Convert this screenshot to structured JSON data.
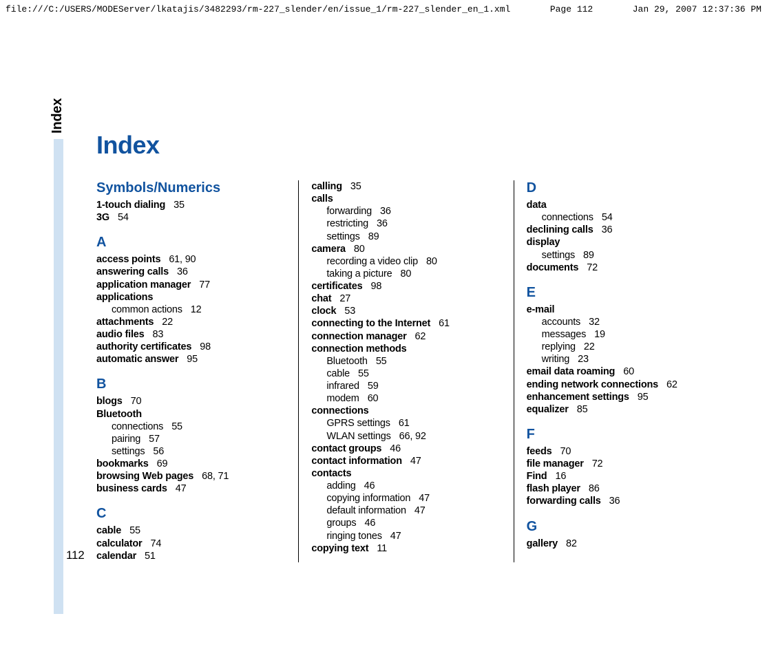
{
  "header": {
    "path": "file:///C:/USERS/MODEServer/lkatajis/3482293/rm-227_slender/en/issue_1/rm-227_slender_en_1.xml",
    "page_label": "Page 112",
    "timestamp": "Jan 29, 2007 12:37:36 PM"
  },
  "side_tab": "Index",
  "page_number": "112",
  "title": "Index",
  "columns": [
    {
      "sections": [
        {
          "letter": "Symbols/Numerics",
          "first": true,
          "entries": [
            {
              "term": "1-touch dialing",
              "pages": "35"
            },
            {
              "term": "3G",
              "pages": "54"
            }
          ]
        },
        {
          "letter": "A",
          "entries": [
            {
              "term": "access points",
              "pages": "61, 90"
            },
            {
              "term": "answering calls",
              "pages": "36"
            },
            {
              "term": "application manager",
              "pages": "77"
            },
            {
              "term": "applications",
              "pages": "",
              "children": [
                {
                  "term": "common actions",
                  "pages": "12"
                }
              ]
            },
            {
              "term": "attachments",
              "pages": "22"
            },
            {
              "term": "audio files",
              "pages": "83"
            },
            {
              "term": "authority certificates",
              "pages": "98"
            },
            {
              "term": "automatic answer",
              "pages": "95"
            }
          ]
        },
        {
          "letter": "B",
          "entries": [
            {
              "term": "blogs",
              "pages": "70"
            },
            {
              "term": "Bluetooth",
              "pages": "",
              "children": [
                {
                  "term": "connections",
                  "pages": "55"
                },
                {
                  "term": "pairing",
                  "pages": "57"
                },
                {
                  "term": "settings",
                  "pages": "56"
                }
              ]
            },
            {
              "term": "bookmarks",
              "pages": "69"
            },
            {
              "term": "browsing Web pages",
              "pages": "68, 71"
            },
            {
              "term": "business cards",
              "pages": "47"
            }
          ]
        },
        {
          "letter": "C",
          "entries": [
            {
              "term": "cable",
              "pages": "55"
            },
            {
              "term": "calculator",
              "pages": "74"
            },
            {
              "term": "calendar",
              "pages": "51"
            }
          ]
        }
      ]
    },
    {
      "sections": [
        {
          "letter": "",
          "first": true,
          "entries": [
            {
              "term": "calling",
              "pages": "35"
            },
            {
              "term": "calls",
              "pages": "",
              "children": [
                {
                  "term": "forwarding",
                  "pages": "36"
                },
                {
                  "term": "restricting",
                  "pages": "36"
                },
                {
                  "term": "settings",
                  "pages": "89"
                }
              ]
            },
            {
              "term": "camera",
              "pages": "80",
              "children": [
                {
                  "term": "recording a video clip",
                  "pages": "80"
                },
                {
                  "term": "taking a picture",
                  "pages": "80"
                }
              ]
            },
            {
              "term": "certificates",
              "pages": "98"
            },
            {
              "term": "chat",
              "pages": "27"
            },
            {
              "term": "clock",
              "pages": "53"
            },
            {
              "term": "connecting to the Internet",
              "pages": "61"
            },
            {
              "term": "connection manager",
              "pages": "62"
            },
            {
              "term": "connection methods",
              "pages": "",
              "children": [
                {
                  "term": "Bluetooth",
                  "pages": "55"
                },
                {
                  "term": "cable",
                  "pages": "55"
                },
                {
                  "term": "infrared",
                  "pages": "59"
                },
                {
                  "term": "modem",
                  "pages": "60"
                }
              ]
            },
            {
              "term": "connections",
              "pages": "",
              "children": [
                {
                  "term": "GPRS settings",
                  "pages": "61"
                },
                {
                  "term": "WLAN settings",
                  "pages": "66, 92"
                }
              ]
            },
            {
              "term": "contact groups",
              "pages": "46"
            },
            {
              "term": "contact information",
              "pages": "47"
            },
            {
              "term": "contacts",
              "pages": "",
              "children": [
                {
                  "term": "adding",
                  "pages": "46"
                },
                {
                  "term": "copying information",
                  "pages": "47"
                },
                {
                  "term": "default information",
                  "pages": "47"
                },
                {
                  "term": "groups",
                  "pages": "46"
                },
                {
                  "term": "ringing tones",
                  "pages": "47"
                }
              ]
            },
            {
              "term": "copying text",
              "pages": "11"
            }
          ]
        }
      ]
    },
    {
      "sections": [
        {
          "letter": "D",
          "first": true,
          "entries": [
            {
              "term": "data",
              "pages": "",
              "children": [
                {
                  "term": "connections",
                  "pages": "54"
                }
              ]
            },
            {
              "term": "declining calls",
              "pages": "36"
            },
            {
              "term": "display",
              "pages": "",
              "children": [
                {
                  "term": "settings",
                  "pages": "89"
                }
              ]
            },
            {
              "term": "documents",
              "pages": "72"
            }
          ]
        },
        {
          "letter": "E",
          "entries": [
            {
              "term": "e-mail",
              "pages": "",
              "children": [
                {
                  "term": "accounts",
                  "pages": "32"
                },
                {
                  "term": "messages",
                  "pages": "19"
                },
                {
                  "term": "replying",
                  "pages": "22"
                },
                {
                  "term": "writing",
                  "pages": "23"
                }
              ]
            },
            {
              "term": "email data roaming",
              "pages": "60"
            },
            {
              "term": "ending network connections",
              "pages": "62"
            },
            {
              "term": "enhancement settings",
              "pages": "95"
            },
            {
              "term": "equalizer",
              "pages": "85"
            }
          ]
        },
        {
          "letter": "F",
          "entries": [
            {
              "term": "feeds",
              "pages": "70"
            },
            {
              "term": "file manager",
              "pages": "72"
            },
            {
              "term": "Find",
              "pages": "16"
            },
            {
              "term": "flash player",
              "pages": "86"
            },
            {
              "term": "forwarding calls",
              "pages": "36"
            }
          ]
        },
        {
          "letter": "G",
          "entries": [
            {
              "term": "gallery",
              "pages": "82"
            }
          ]
        }
      ]
    }
  ]
}
